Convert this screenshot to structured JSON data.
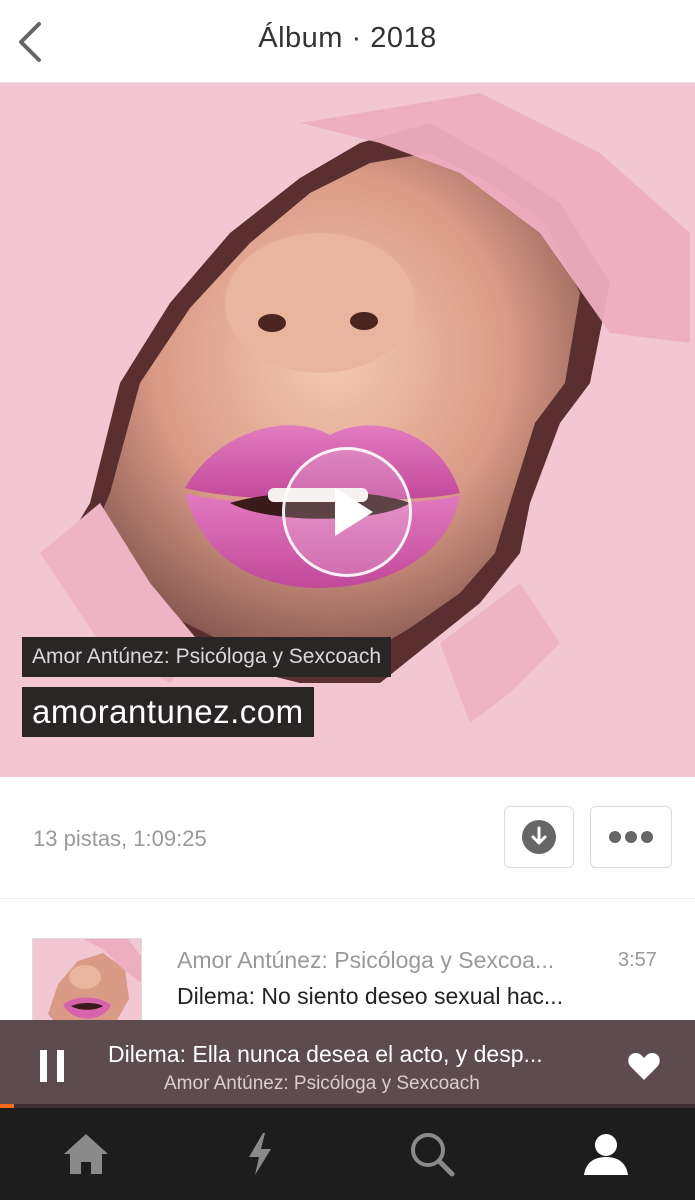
{
  "header": {
    "title": "Álbum · 2018",
    "back_icon": "chevron-left-icon"
  },
  "artwork": {
    "caption_line_1": "Amor Antúnez: Psicóloga y Sexcoach",
    "caption_line_2": "amorantunez.com",
    "play_icon": "play-icon",
    "background_color": "#f3c6d3"
  },
  "album_info": {
    "summary": "13 pistas, 1:09:25",
    "download_icon": "download-icon",
    "more_icon": "more-dots-icon"
  },
  "tracks": [
    {
      "artist": "Amor Antúnez: Psicóloga y Sexcoa...",
      "title": "Dilema: No siento deseo sexual hac...",
      "duration": "3:57"
    }
  ],
  "player": {
    "title": "Dilema: Ella nunca desea el acto, y desp...",
    "artist": "Amor Antúnez: Psicóloga y Sexcoach",
    "state": "playing",
    "progress": 0.02,
    "liked": true,
    "accent_color": "#f26a1b"
  },
  "tab_bar": {
    "tabs": [
      {
        "name": "home",
        "icon": "home-icon",
        "active": false
      },
      {
        "name": "stream",
        "icon": "lightning-icon",
        "active": false
      },
      {
        "name": "search",
        "icon": "search-icon",
        "active": false
      },
      {
        "name": "profile",
        "icon": "profile-icon",
        "active": true
      }
    ]
  }
}
